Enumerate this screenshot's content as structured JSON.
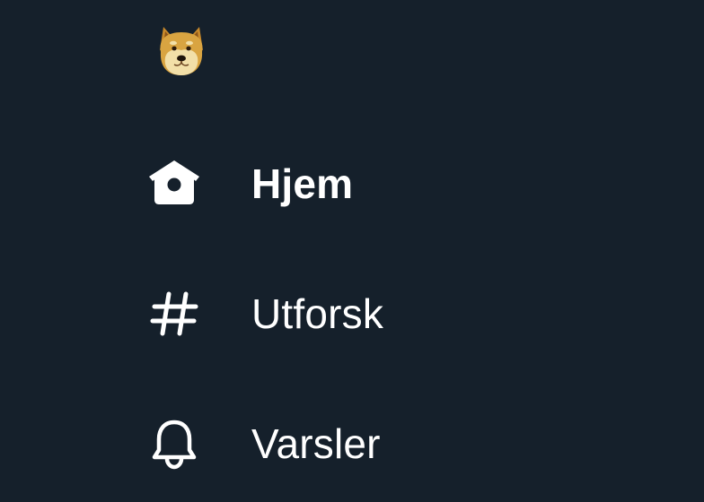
{
  "logo": {
    "icon": "doge-logo-icon"
  },
  "nav": {
    "items": [
      {
        "label": "Hjem",
        "icon": "home-icon",
        "active": true
      },
      {
        "label": "Utforsk",
        "icon": "hashtag-icon",
        "active": false
      },
      {
        "label": "Varsler",
        "icon": "bell-icon",
        "active": false
      }
    ]
  },
  "colors": {
    "background": "#15202b",
    "text": "#ffffff"
  }
}
